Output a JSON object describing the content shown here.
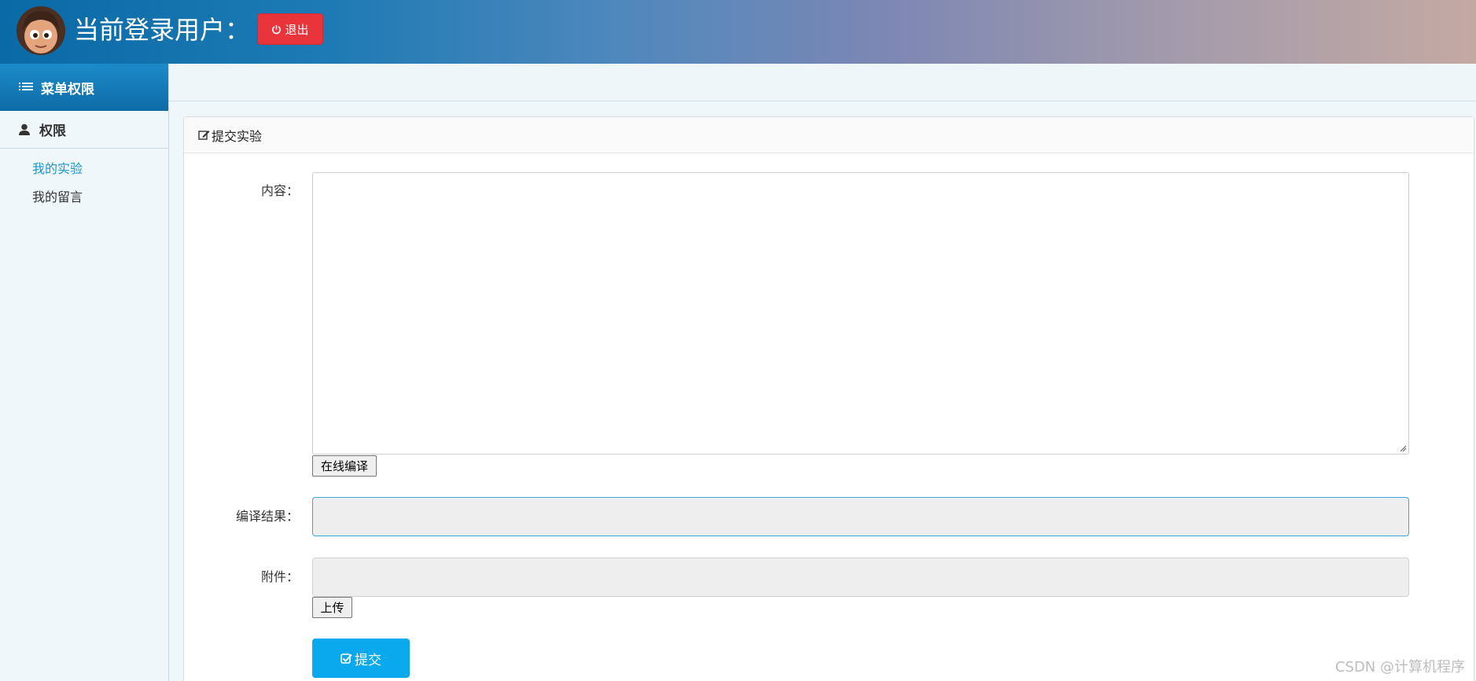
{
  "header": {
    "title": "当前登录用户：",
    "logout_label": "退出",
    "accent_color": "#e8343a"
  },
  "sidebar": {
    "heading": "菜单权限",
    "group_label": "权限",
    "items": [
      {
        "label": "我的实验",
        "active": true
      },
      {
        "label": "我的留言",
        "active": false
      }
    ]
  },
  "panel": {
    "title": "提交实验",
    "content_label": "内容：",
    "compile_button": "在线编译",
    "result_label": "编译结果：",
    "attachment_label": "附件：",
    "upload_button": "上传",
    "submit_button": "提交"
  },
  "watermark": "CSDN @计算机程序"
}
